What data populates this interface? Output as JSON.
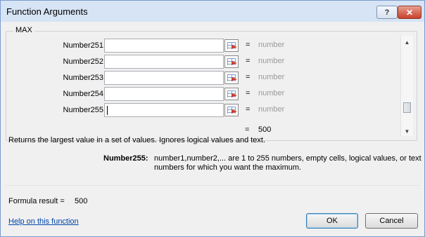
{
  "window": {
    "title": "Function Arguments"
  },
  "titlebar": {
    "help_label": "?",
    "close_label": "✕"
  },
  "function_name": "MAX",
  "arguments": [
    {
      "label": "Number251",
      "value": "",
      "equals": "=",
      "hint": "number"
    },
    {
      "label": "Number252",
      "value": "",
      "equals": "=",
      "hint": "number"
    },
    {
      "label": "Number253",
      "value": "",
      "equals": "=",
      "hint": "number"
    },
    {
      "label": "Number254",
      "value": "",
      "equals": "=",
      "hint": "number"
    },
    {
      "label": "Number255",
      "value": "",
      "equals": "=",
      "hint": "number"
    }
  ],
  "result": {
    "equals": "=",
    "value": "500"
  },
  "description": "Returns the largest value in a set of values. Ignores logical values and text.",
  "param_help": {
    "name": "Number255:",
    "text": "number1,number2,... are 1 to 255 numbers, empty cells, logical values, or text numbers for which you want the maximum."
  },
  "formula_result": {
    "label": "Formula result =",
    "value": "500"
  },
  "help_link": "Help on this function",
  "buttons": {
    "ok": "OK",
    "cancel": "Cancel"
  }
}
